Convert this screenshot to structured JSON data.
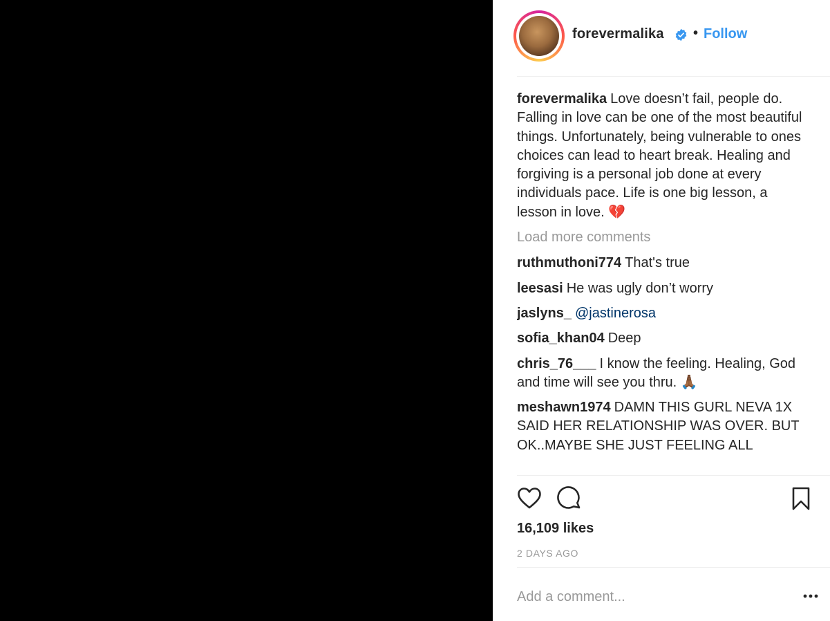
{
  "post": {
    "username": "forevermalika",
    "dot": "•",
    "follow_label": "Follow"
  },
  "comments": [
    {
      "user": "forevermalika",
      "text": "Love doesn’t fail, people do. Falling in love can be one of the most beautiful things. Unfortunately, being vulnerable to ones choices can lead to heart break. Healing and forgiving is a personal job done at every individuals pace. Life is one big lesson, a lesson in love. ",
      "emoji": "💔"
    },
    {
      "user": "ruthmuthoni774",
      "text": "That's true"
    },
    {
      "user": "leesasi",
      "text": "He was ugly don’t worry"
    },
    {
      "user": "jaslyns_",
      "text": "@jastinerosa"
    },
    {
      "user": "sofia_khan04",
      "text": "Deep"
    },
    {
      "user": "chris_76___",
      "text": "I know the feeling. Healing, God and time will see you thru. ",
      "emoji": "🙏🏾"
    },
    {
      "user": "meshawn1974",
      "text": "DAMN THIS GURL NEVA 1X SAID HER RELATIONSHIP WAS OVER. BUT OK..MAYBE SHE JUST FEELING ALL"
    }
  ],
  "load_more_label": "Load more comments",
  "likes_text": "16,109 likes",
  "date_text": "2 DAYS AGO",
  "add_comment_placeholder": "Add a comment...",
  "colors": {
    "accent": "#3897f0",
    "mention": "#003569",
    "muted": "#999999"
  },
  "icons": [
    "verified-badge-icon",
    "heart-icon",
    "comment-icon",
    "bookmark-icon",
    "more-options-icon"
  ]
}
